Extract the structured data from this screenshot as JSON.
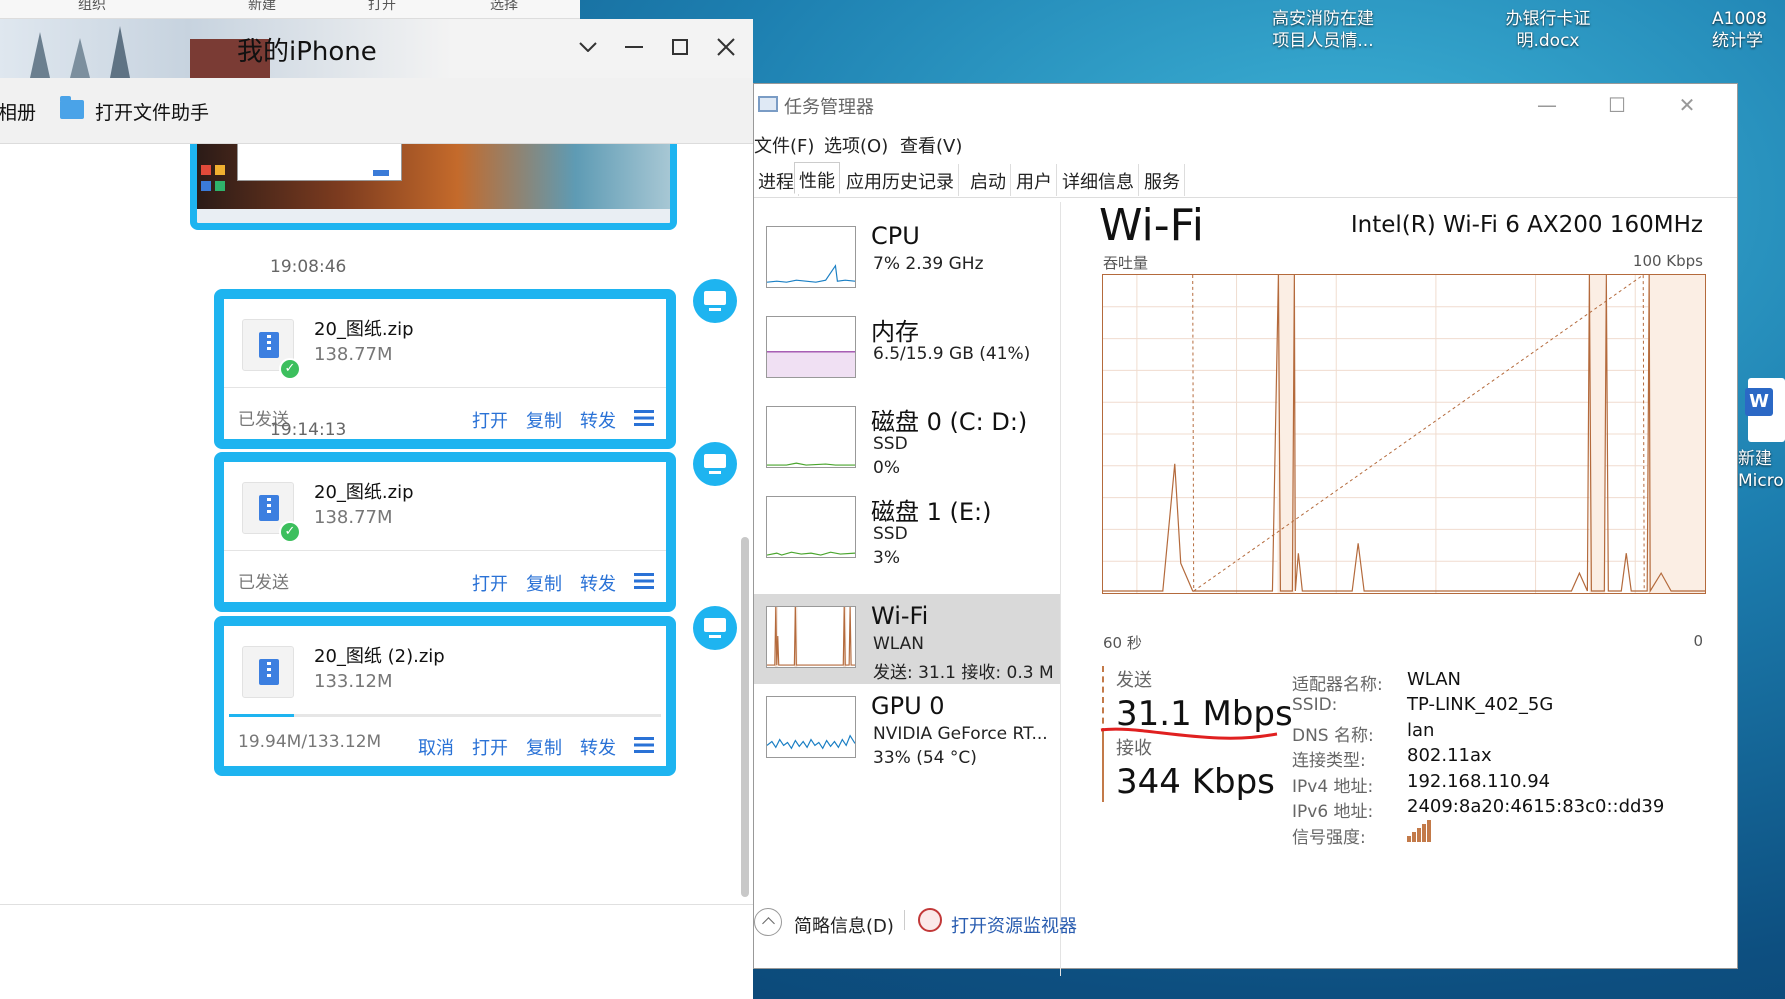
{
  "desktop": {
    "icons": [
      {
        "label_line1": "高安消防在建",
        "label_line2": "项目人员情..."
      },
      {
        "label_line1": "办银行卡证",
        "label_line2": "明.docx"
      },
      {
        "label_line1": "A1008",
        "label_line2": "统计学"
      }
    ],
    "right_icon": {
      "label_line1": "新建",
      "label_line2": "Micro",
      "glyph": "W"
    }
  },
  "explorer_strip": {
    "items": [
      "组织",
      "新建",
      "打开",
      "选择"
    ]
  },
  "chat_window": {
    "title": "我的iPhone",
    "toolbar": {
      "album_label": "相册",
      "open_helper_label": "打开文件助手"
    },
    "messages": [
      {
        "timestamp": "19:08:46",
        "file_name": "20_图纸.zip",
        "file_size": "138.77M",
        "status": "已发送",
        "actions": [
          "打开",
          "复制",
          "转发"
        ],
        "progress": null,
        "sent": true
      },
      {
        "timestamp": "19:14:13",
        "file_name": "20_图纸.zip",
        "file_size": "138.77M",
        "status": "已发送",
        "actions": [
          "打开",
          "复制",
          "转发"
        ],
        "progress": null,
        "sent": true
      },
      {
        "timestamp": "",
        "file_name": "20_图纸 (2).zip",
        "file_size": "133.12M",
        "status": "19.94M/133.12M",
        "actions": [
          "取消",
          "打开",
          "复制",
          "转发"
        ],
        "progress": 0.15,
        "sent": false
      }
    ]
  },
  "task_manager": {
    "title": "任务管理器",
    "menu": [
      "文件(F)",
      "选项(O)",
      "查看(V)"
    ],
    "tabs": [
      "进程",
      "性能",
      "应用历史记录",
      "启动",
      "用户",
      "详细信息",
      "服务"
    ],
    "active_tab": "性能",
    "resources": [
      {
        "name": "CPU",
        "sub1": "7%  2.39 GHz",
        "sub2": "",
        "color": "#1a7fc4"
      },
      {
        "name": "内存",
        "sub1": "6.5/15.9 GB (41%)",
        "sub2": "",
        "color": "#8b2a9c"
      },
      {
        "name": "磁盘 0 (C: D:)",
        "sub1": "SSD",
        "sub2": "0%",
        "color": "#4aa52e"
      },
      {
        "name": "磁盘 1 (E:)",
        "sub1": "SSD",
        "sub2": "3%",
        "color": "#4aa52e"
      },
      {
        "name": "Wi-Fi",
        "sub1": "WLAN",
        "sub2": "发送: 31.1  接收: 0.3 M",
        "color": "#b46a3c"
      },
      {
        "name": "GPU 0",
        "sub1": "NVIDIA GeForce RT...",
        "sub2": "33%  (54 °C)",
        "color": "#1a7fc4"
      }
    ],
    "selected_resource": "Wi-Fi",
    "wifi": {
      "title": "Wi-Fi",
      "adapter": "Intel(R) Wi-Fi 6 AX200 160MHz",
      "throughput_label": "吞吐量",
      "max_label": "100 Kbps",
      "time_label": "60 秒",
      "zero_label": "0",
      "send_label": "发送",
      "send_value": "31.1 Mbps",
      "recv_label": "接收",
      "recv_value": "344 Kbps",
      "properties": [
        {
          "label": "适配器名称:",
          "value": "WLAN"
        },
        {
          "label": "SSID:",
          "value": "TP-LINK_402_5G"
        },
        {
          "label": "DNS 名称:",
          "value": "lan"
        },
        {
          "label": "连接类型:",
          "value": "802.11ax"
        },
        {
          "label": "IPv4 地址:",
          "value": "192.168.110.94"
        },
        {
          "label": "IPv6 地址:",
          "value": "2409:8a20:4615:83c0::dd39"
        },
        {
          "label": "信号强度:",
          "value": ""
        }
      ]
    },
    "footer": {
      "fewer_details": "简略信息(D)",
      "open_resmon": "打开资源监视器"
    }
  }
}
